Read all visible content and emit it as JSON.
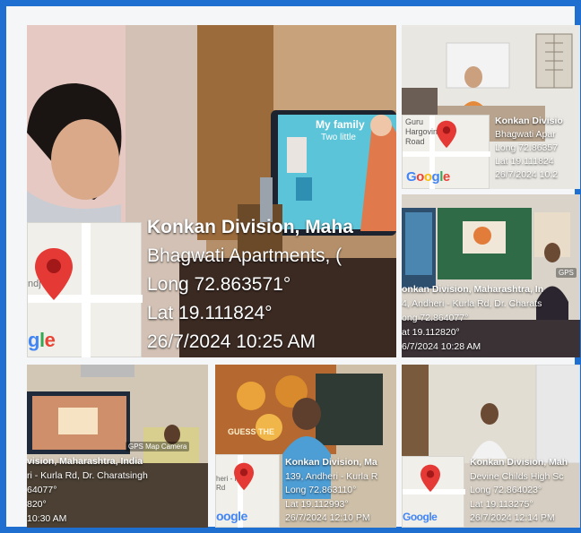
{
  "colors": {
    "frame": "#1f6fd1",
    "pin": "#e53935",
    "caption_text": "#ffffff"
  },
  "icons": [
    "map-pin-icon",
    "google-logo",
    "gps-camera-icon"
  ],
  "google_logo": {
    "g": "G",
    "o1": "o",
    "o2": "o",
    "g2": "g",
    "l": "l",
    "e": "e"
  },
  "tiles": {
    "main": {
      "screen_text_1": "My family",
      "screen_text_2": "Two little",
      "map_label": "ndj",
      "logo_partial": {
        "g": "g",
        "l": "l",
        "e": "e",
        "prefix": "G"
      },
      "line1": "Konkan Division, Maha",
      "line2": "Bhagwati Apartments, (",
      "line3": "Long 72.863571°",
      "line4": "Lat 19.111824°",
      "line5": "26/7/2024 10:25 AM"
    },
    "top_right": {
      "map_label_1": "Guru",
      "map_label_2": "Hargovind",
      "map_label_3": "Road",
      "line1": "Konkan Divisio",
      "line2": "Bhagwati Apar",
      "line3": "Long 72.86357",
      "line4": "Lat 19.111824",
      "line5": "26/7/2024 10:2"
    },
    "mid_right": {
      "gps_label": "GPS",
      "line1": "onkan Division, Maharashtra, In",
      "line2": "4, Andheri - Kurla Rd, Dr. Charats",
      "line3": "ong 72.864077°",
      "line4": "at 19.112820°",
      "line5": "6/7/2024 10:28 AM"
    },
    "bottom_left": {
      "gps_label": "GPS Map Camera",
      "line1": "vision, Maharashtra, India",
      "line2": "ri - Kurla Rd, Dr. Charatsingh",
      "line3": "64077°",
      "line4": "820°",
      "line5": "10:30 AM"
    },
    "bottom_mid": {
      "map_label_1": "heri - Kurla",
      "map_label_2": "Rd",
      "screen_text": "GUESS THE",
      "line1": "Konkan Division, Ma",
      "line2": "139, Andheri - Kurla R",
      "line3": "Long 72.863110°",
      "line4": "Lat 19.112993°",
      "line5": "26/7/2024 12:10 PM",
      "logo_partial": "oogle"
    },
    "bottom_right": {
      "line1": "Konkan Division, Mah",
      "line2": "Devine Childs High Sc",
      "line3": "Long 72.864023°",
      "line4": "Lat 19.113275°",
      "line5": "26/7/2024 12:14 PM",
      "logo_partial": "Google"
    }
  }
}
